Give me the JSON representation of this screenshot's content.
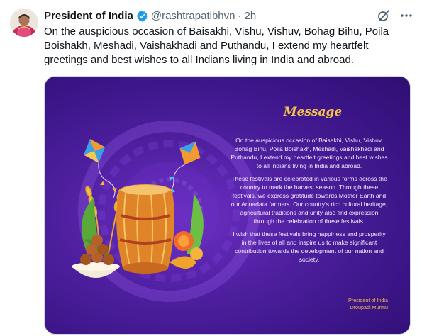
{
  "author": {
    "name": "President of India",
    "handle": "@rashtrapatibhvn",
    "separator": "·",
    "time": "2h"
  },
  "tweet": {
    "text": "On the auspicious occasion of Baisakhi, Vishu, Vishuv, Bohag Bihu, Poila Boishakh, Meshadi, Vaishakhadi and Puthandu, I extend my heartfelt greetings and best wishes to all Indians living in India and abroad."
  },
  "icons": {
    "verified": "verified-badge-icon",
    "grok": "grok-icon",
    "more": "more-options-icon"
  },
  "card": {
    "title": "Message",
    "paragraphs": [
      "On the auspicious occasion of Baisakhi, Vishu, Vishuv, Bohag Bihu, Poila Boishakh, Meshadi, Vaishakhadi and Puthandu, I extend my heartfelt greetings and best wishes to all Indians living in India and abroad.",
      "These festivals are celebrated in various forms across the country to mark the harvest season. Through these festivals, we express gratitude towards Mother Earth and our Annadata farmers. Our country's rich cultural heritage, agricultural traditions and unity also find expression through the celebration of these festivals.",
      "I wish that these festivals bring happiness and prosperity in the lives of all and inspire us to make significant contribution towards the development of our nation and society."
    ],
    "signature_line1": "President of India",
    "signature_line2": "Droupadi Murmu"
  },
  "colors": {
    "card_bg": "#4d1f9e",
    "title_gold": "#f5c64a",
    "verified_blue": "#1d9bf0",
    "muted_text": "#536471"
  }
}
